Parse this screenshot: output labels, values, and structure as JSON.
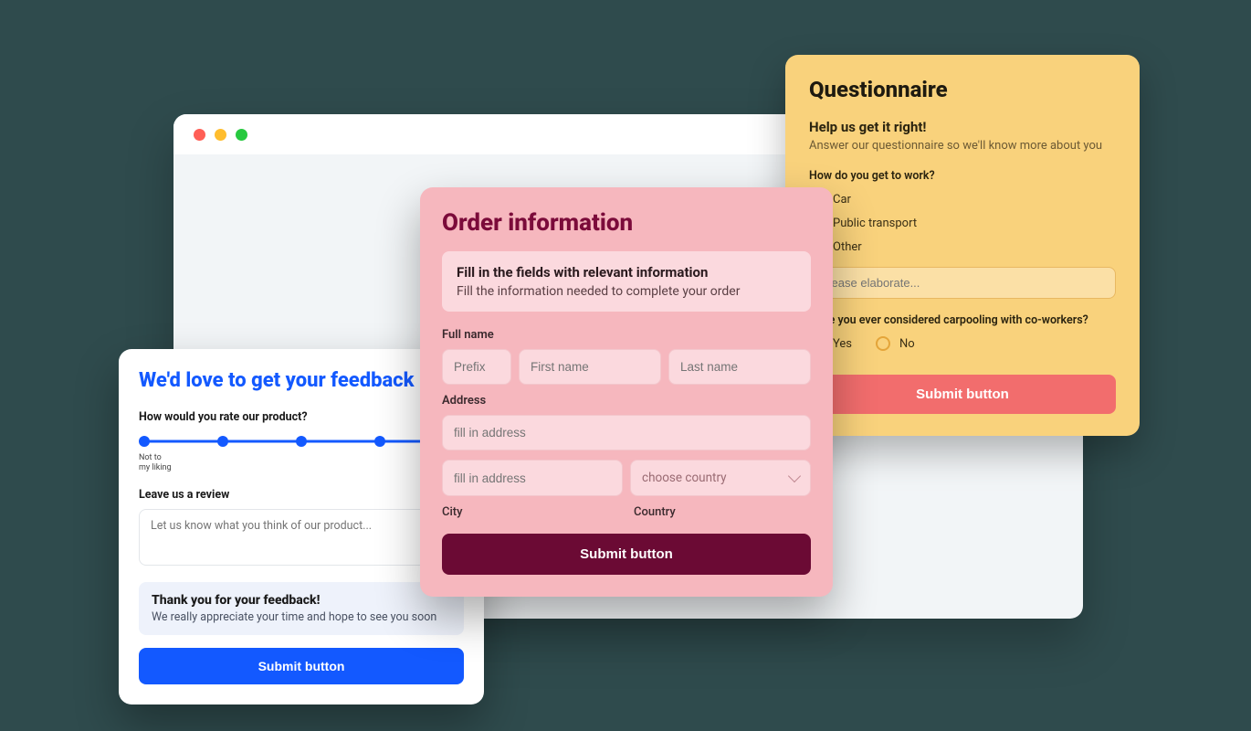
{
  "questionnaire": {
    "title": "Questionnaire",
    "subtitle": "Help us get it right!",
    "subtext": "Answer our questionnaire so we'll know more about you",
    "q1_label": "How do you get to work?",
    "q1_options": [
      "Car",
      "Public transport",
      "Other"
    ],
    "elaborate_placeholder": "Please elaborate...",
    "q2_label": "Have you ever considered carpooling with co-workers?",
    "q2_options": [
      "Yes",
      "No"
    ],
    "submit": "Submit button"
  },
  "order": {
    "title": "Order information",
    "info_header": "Fill in the fields with relevant information",
    "info_text": "Fill the information needed to complete your order",
    "fullname_label": "Full name",
    "prefix_ph": "Prefix",
    "first_ph": "First name",
    "last_ph": "Last name",
    "address_label": "Address",
    "addr_ph": "fill in address",
    "city_label": "City",
    "country_label": "Country",
    "country_ph": "choose country",
    "submit": "Submit button"
  },
  "feedback": {
    "title": "We'd love to get your feedback",
    "rate_label": "How would you rate our product?",
    "legend_low_1": "Not to",
    "legend_low_2": "my liking",
    "review_label": "Leave us a review",
    "review_ph": "Let us know what you think of our product...",
    "thanks_header": "Thank you for your feedback!",
    "thanks_text": "We really appreciate your time and hope to see you soon",
    "submit": "Submit button"
  }
}
